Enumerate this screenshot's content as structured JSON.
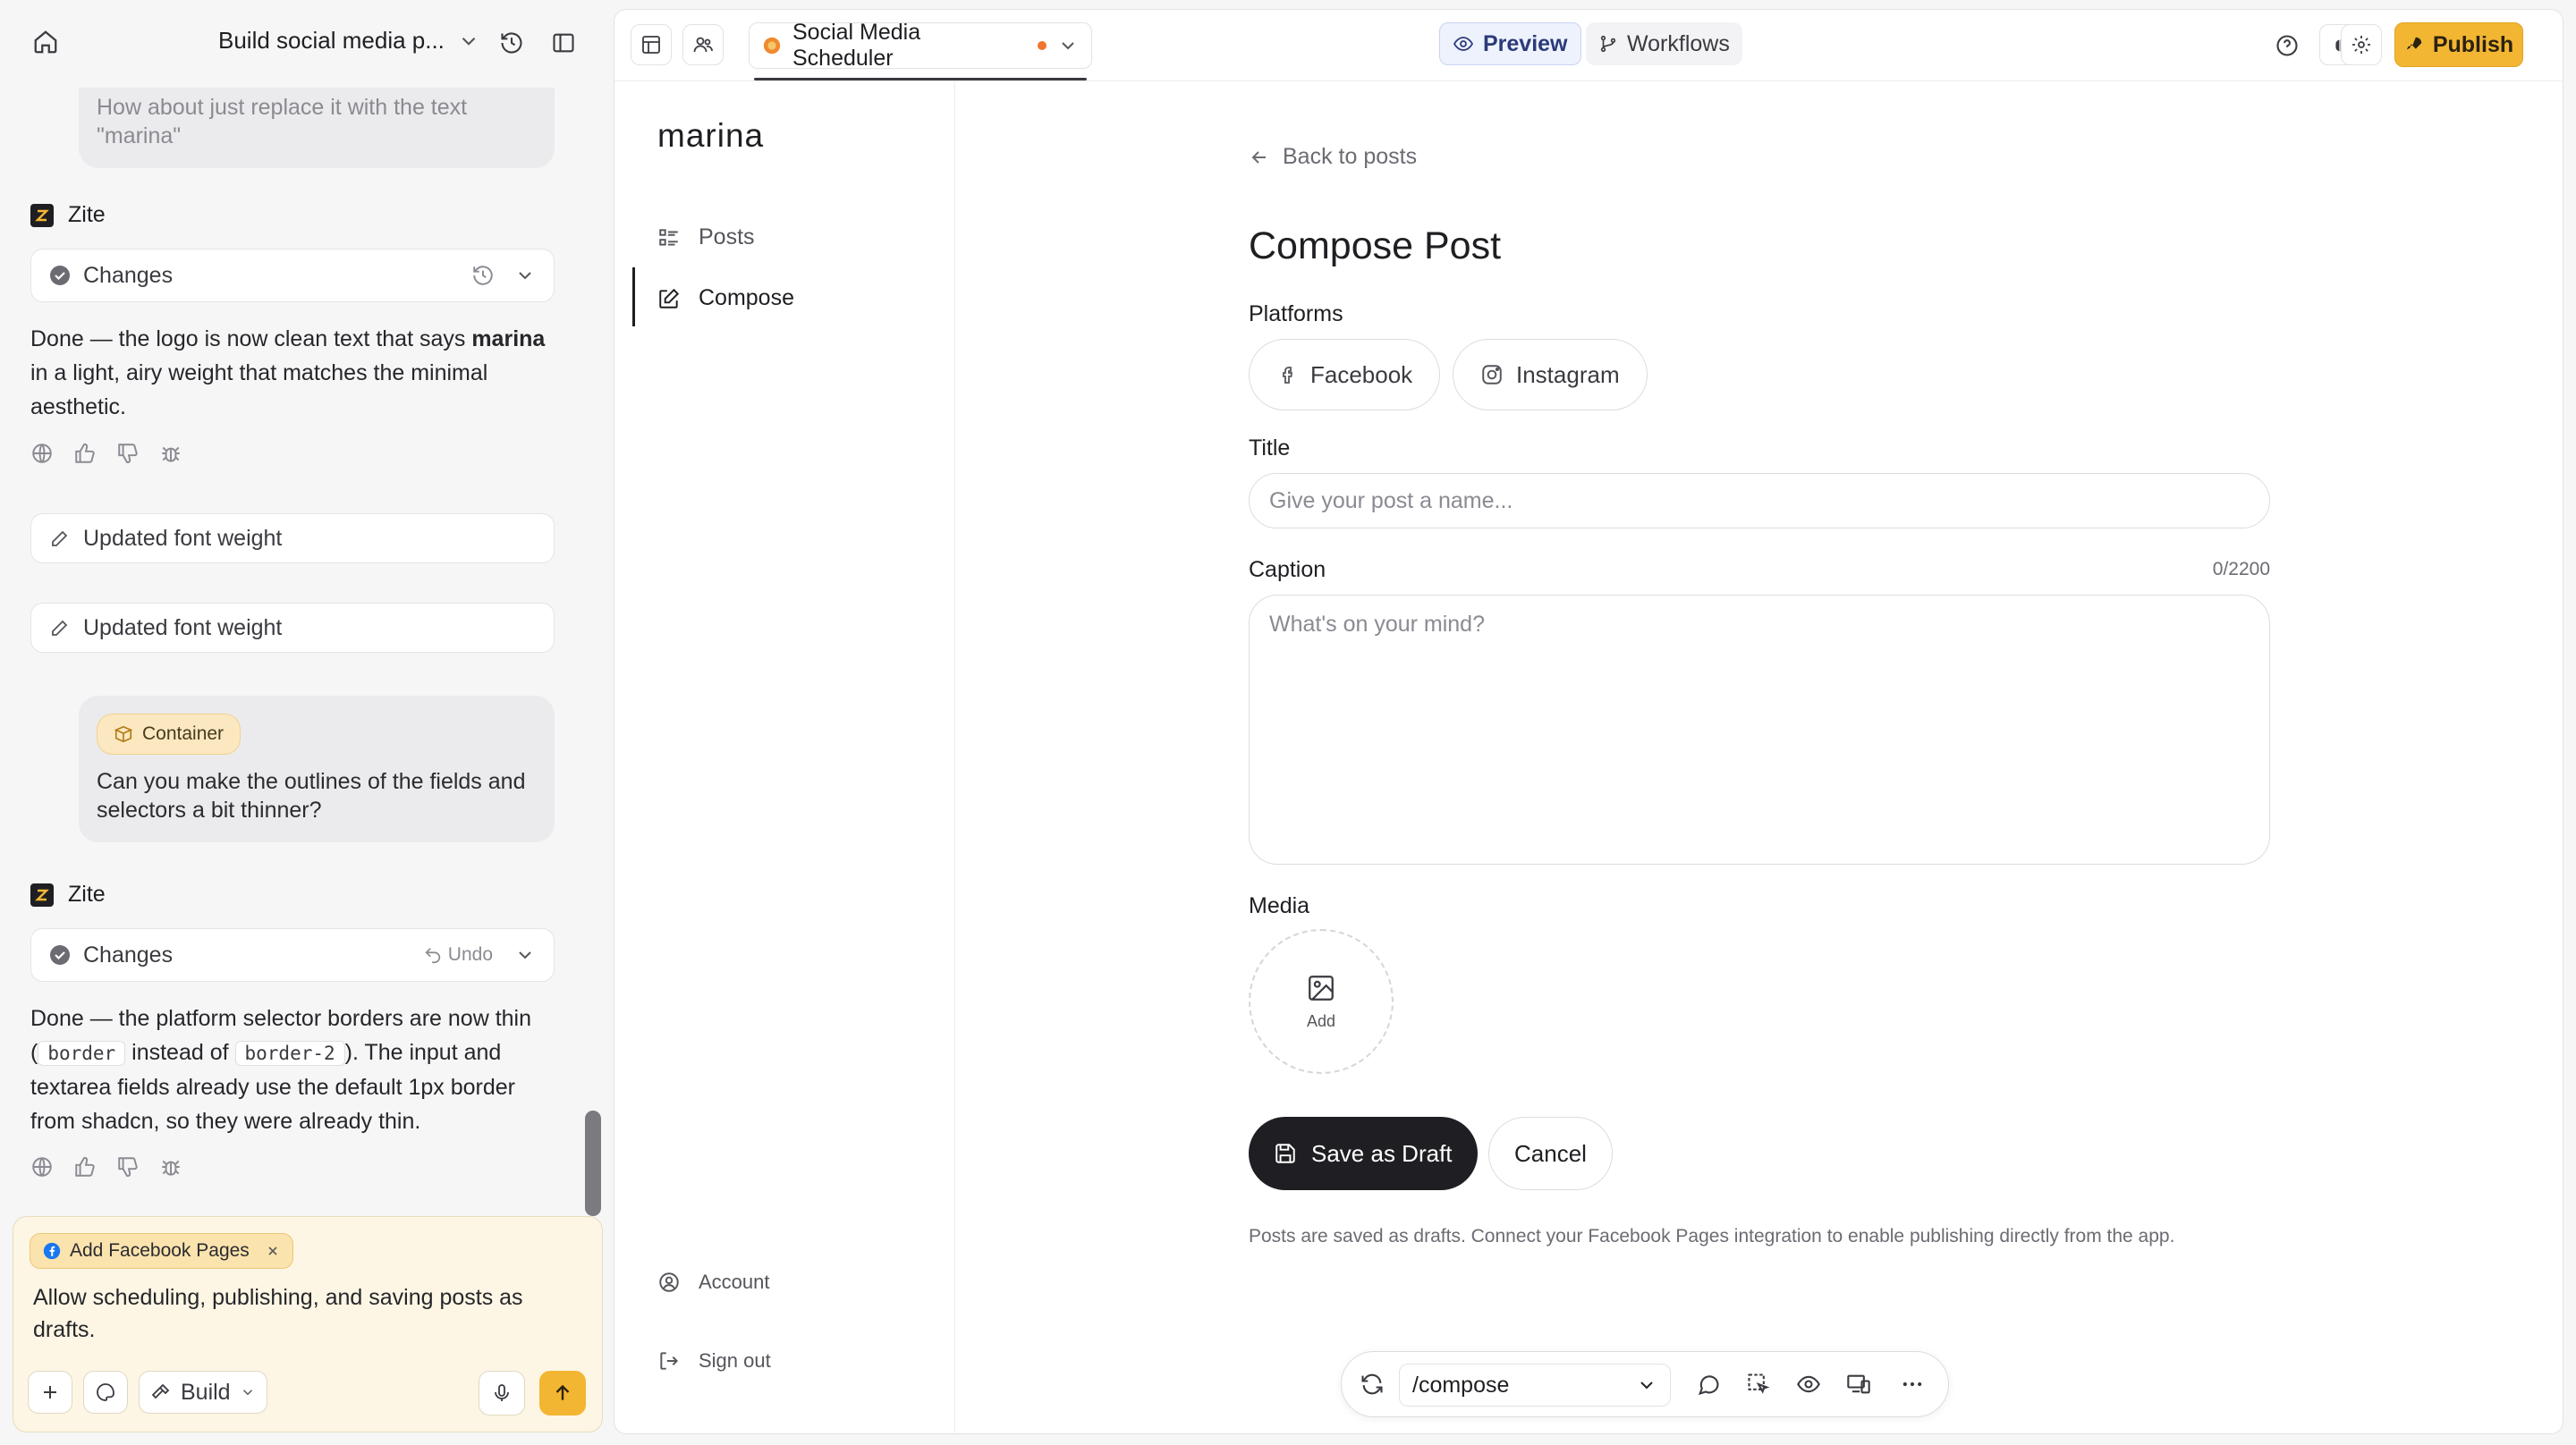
{
  "chat": {
    "project_title": "Build social media p...",
    "messages": {
      "user_1_tail": "How about just replace it with the text \"marina\"",
      "zite_name": "Zite",
      "changes_label": "Changes",
      "reply_1_pre": "Done — the logo is now clean text that says ",
      "reply_1_bold": "marina",
      "reply_1_post": " in a light, airy weight that matches the minimal aesthetic.",
      "update_1": "Updated font weight",
      "update_2": "Updated font weight",
      "container_tag": "Container",
      "user_2": "Can you make the outlines of the fields and selectors a bit thinner?",
      "undo_label": "Undo",
      "reply_2_a": "Done — the platform selector borders are now thin (",
      "reply_2_code_1": "border",
      "reply_2_b": " instead of ",
      "reply_2_code_2": "border-2",
      "reply_2_c": "). The input and textarea fields already use the default 1px border from shadcn, so they were already thin."
    },
    "composer": {
      "chip_label": "Add Facebook Pages",
      "text": "Allow scheduling, publishing, and saving posts as drafts.",
      "mode_label": "Build"
    }
  },
  "frame": {
    "app_name": "Social Media Scheduler",
    "preview_label": "Preview",
    "workflows_label": "Workflows",
    "publish_label": "Publish"
  },
  "app": {
    "brand": "marina",
    "nav": {
      "posts": "Posts",
      "compose": "Compose",
      "account": "Account",
      "sign_out": "Sign out"
    },
    "compose": {
      "back": "Back to posts",
      "title": "Compose Post",
      "platforms_label": "Platforms",
      "platform_facebook": "Facebook",
      "platform_instagram": "Instagram",
      "title_label": "Title",
      "title_placeholder": "Give your post a name...",
      "caption_label": "Caption",
      "caption_counter": "0/2200",
      "caption_placeholder": "What's on your mind?",
      "media_label": "Media",
      "media_add": "Add",
      "save_draft": "Save as Draft",
      "cancel": "Cancel",
      "footnote": "Posts are saved as drafts. Connect your Facebook Pages integration to enable publishing directly from the app."
    },
    "route": "/compose"
  },
  "colors": {
    "accent": "#f3b633",
    "dark": "#1f1f23",
    "preview_bg": "#eef2fd",
    "unsaved_dot": "#f0732f"
  }
}
